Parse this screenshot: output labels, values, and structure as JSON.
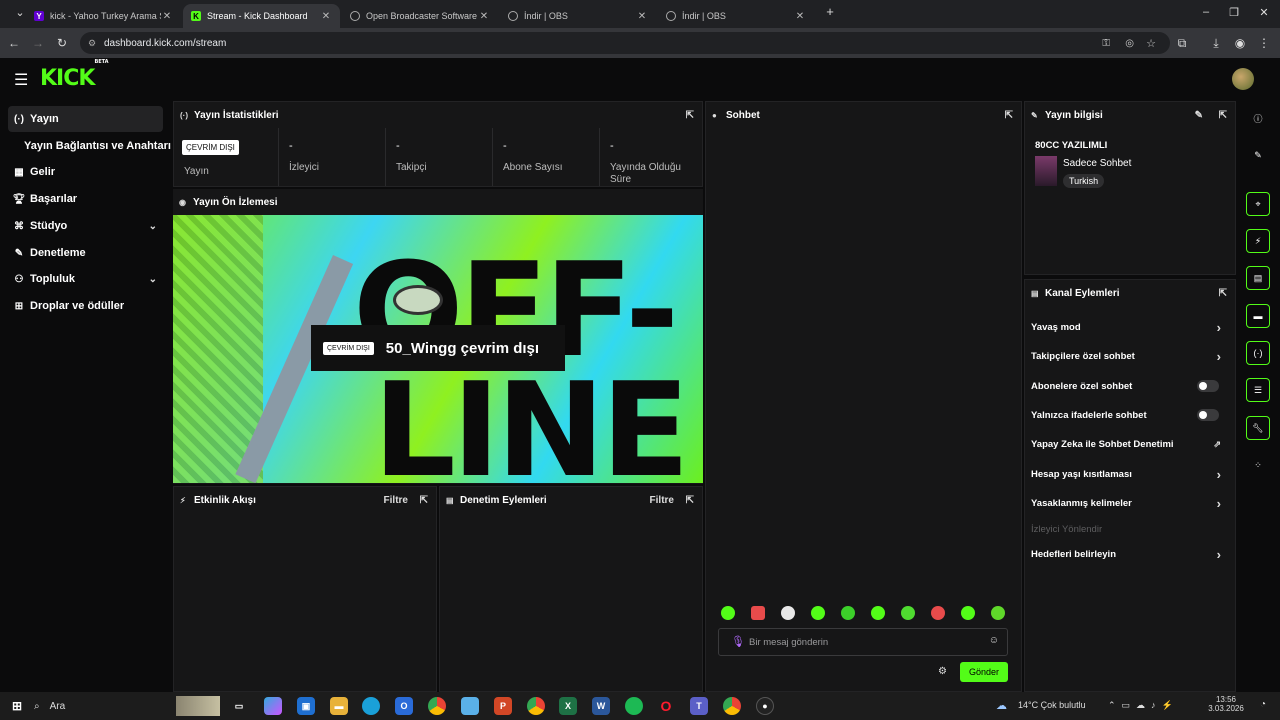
{
  "browser": {
    "tabs": [
      {
        "title": "kick - Yahoo Turkey Arama Son",
        "icon": "yahoo-icon",
        "active": false
      },
      {
        "title": "Stream - Kick Dashboard",
        "icon": "kick-icon",
        "active": true
      },
      {
        "title": "Open Broadcaster Software | O",
        "icon": "globe-icon",
        "active": false
      },
      {
        "title": "İndir | OBS",
        "icon": "globe-icon",
        "active": false
      },
      {
        "title": "İndir | OBS",
        "icon": "globe-icon",
        "active": false
      }
    ],
    "url": "dashboard.kick.com/stream"
  },
  "header": {
    "logo": "KICK",
    "logo_sup": "BETA"
  },
  "sidebar": {
    "items": [
      {
        "label": "Yayın",
        "icon": "broadcast-icon",
        "active": true
      },
      {
        "label": "Yayın Bağlantısı ve Anahtarı",
        "icon": "",
        "active": false
      },
      {
        "label": "Gelir",
        "icon": "chart-icon",
        "active": false
      },
      {
        "label": "Başarılar",
        "icon": "trophy-icon",
        "active": false
      },
      {
        "label": "Stüdyo",
        "icon": "studio-icon",
        "active": false,
        "expand": true
      },
      {
        "label": "Denetleme",
        "icon": "wrench-icon",
        "active": false
      },
      {
        "label": "Topluluk",
        "icon": "people-icon",
        "active": false,
        "expand": true
      },
      {
        "label": "Droplar ve ödüller",
        "icon": "gift-icon",
        "active": false
      }
    ]
  },
  "stats": {
    "title": "Yayın İstatistikleri",
    "status_badge": "ÇEVRİM DIŞI",
    "status_label": "Yayın",
    "items": [
      {
        "value": "-",
        "label": "İzleyici"
      },
      {
        "value": "-",
        "label": "Takipçi"
      },
      {
        "value": "-",
        "label": "Abone Sayısı"
      },
      {
        "value": "-",
        "label": "Yayında Olduğu Süre"
      }
    ]
  },
  "preview": {
    "title": "Yayın Ön İzlemesi",
    "badge": "ÇEVRİM DIŞI",
    "message": "50_Wingg çevrim dışı",
    "art_top": "OFF-",
    "art_bottom": "LINE"
  },
  "activity": {
    "title": "Etkinlik Akışı",
    "filter": "Filtre"
  },
  "moderation": {
    "title": "Denetim Eylemleri",
    "filter": "Filtre"
  },
  "chat": {
    "title": "Sohbet",
    "placeholder": "Bir mesaj gönderin",
    "send": "Gönder"
  },
  "stream_info": {
    "title": "Yayın bilgisi",
    "stream_title": "80CC YAZILIMLI",
    "category": "Sadece Sohbet",
    "language": "Turkish"
  },
  "channel_actions": {
    "title": "Kanal Eylemleri",
    "items": [
      {
        "label": "Yavaş mod",
        "control": "arrow"
      },
      {
        "label": "Takipçilere özel sohbet",
        "control": "arrow"
      },
      {
        "label": "Abonelere özel sohbet",
        "control": "toggle"
      },
      {
        "label": "Yalnızca ifadelerle sohbet",
        "control": "toggle"
      },
      {
        "label": "Yapay Zeka ile Sohbet Denetimi",
        "control": "external"
      },
      {
        "label": "Hesap yaşı kısıtlaması",
        "control": "arrow"
      },
      {
        "label": "Yasaklanmış kelimeler",
        "control": "arrow"
      },
      {
        "label": "İzleyici Yönlendir",
        "control": "disabled"
      },
      {
        "label": "Hedefleri belirleyin",
        "control": "arrow"
      }
    ]
  },
  "taskbar": {
    "search": "Ara",
    "weather": "14°C  Çok bulutlu",
    "time": "13:56",
    "date": "3.03.2026"
  },
  "colors": {
    "accent": "#53fc18",
    "panel": "#161617",
    "background": "#0b0b0c"
  }
}
